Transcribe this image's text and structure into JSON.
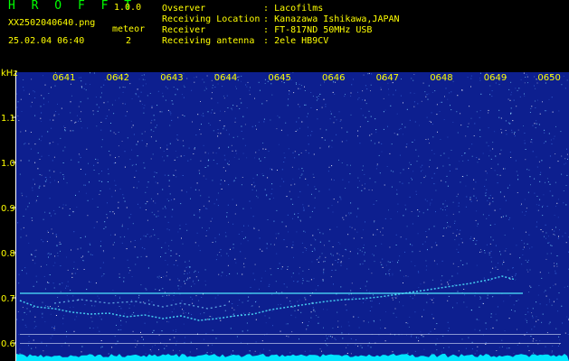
{
  "header": {
    "app_title": "H R O F F T",
    "version": "1.0.0",
    "file_name": "XX2502040640.png",
    "datetime": "25.02.04 06:40",
    "detection_label": "meteor",
    "detection_count": "2",
    "info": [
      {
        "key": "Ovserver",
        "sep": ":",
        "value": "Lacofilms"
      },
      {
        "key": "Receiving Location",
        "sep": ":",
        "value": "Kanazawa Ishikawa,JAPAN"
      },
      {
        "key": "Receiver",
        "sep": ":",
        "value": "FT-817ND 50MHz USB"
      },
      {
        "key": "Receiving antenna",
        "sep": ":",
        "value": "2ele HB9CV"
      }
    ]
  },
  "spectrogram": {
    "y_unit": "kHz",
    "y_ticks": [
      "1.1",
      "1.0",
      "0.9",
      "0.8",
      "0.7",
      "0.6"
    ],
    "x_ticks": [
      "0641",
      "0642",
      "0643",
      "0644",
      "0645",
      "0646",
      "0647",
      "0648",
      "0649",
      "0650"
    ],
    "colors": {
      "background": "#0d1f8f",
      "speckle": "#7fd8ff",
      "carrier": "#4fe8ff",
      "noise_floor": "#00e5ff",
      "axis_text": "#ffff00",
      "axis_line": "#ffffff"
    },
    "carrier_khz": 0.71,
    "reference_lines_khz": [
      0.62,
      0.6
    ]
  }
}
